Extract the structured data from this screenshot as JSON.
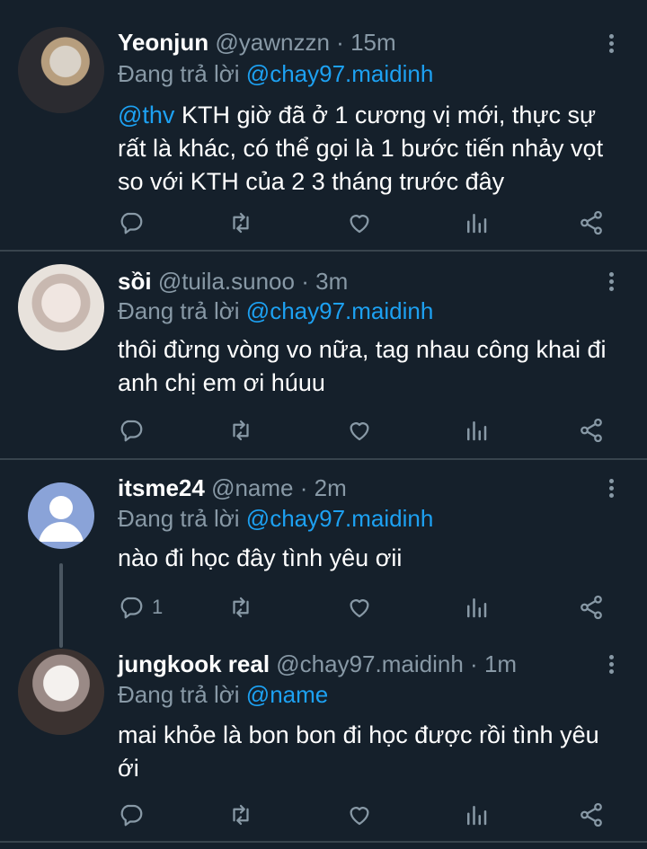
{
  "tweets": [
    {
      "name": "Yeonjun",
      "handle": "@yawnzzn",
      "time": "15m",
      "reply_prefix": "Đang trả lời",
      "reply_to": "@chay97.maidinh",
      "mention": "@thv",
      "text": " KTH giờ đã ở 1 cương vị mới, thực sự rất là khác, có thể gọi là 1 bước tiến nhảy vọt so với KTH của 2 3 tháng trước đây",
      "reply_count": ""
    },
    {
      "name": "sồi",
      "handle": "@tuila.sunoo",
      "time": "3m",
      "reply_prefix": "Đang trả lời",
      "reply_to": "@chay97.maidinh",
      "text": "thôi đừng vòng vo nữa, tag nhau công khai đi anh chị em ơi húuu",
      "reply_count": ""
    },
    {
      "name": "itsme24",
      "handle": "@name",
      "time": "2m",
      "reply_prefix": "Đang trả lời",
      "reply_to": "@chay97.maidinh",
      "text": "nào đi học đây tình yêu ơii",
      "reply_count": "1"
    },
    {
      "name": "jungkook real",
      "handle": "@chay97.maidinh",
      "time": "1m",
      "reply_prefix": "Đang trả lời",
      "reply_to": "@name",
      "text": "mai khỏe là bon bon đi học được rồi tình yêu ới",
      "reply_count": ""
    }
  ],
  "separator": "·",
  "icons": {
    "reply": "reply-icon",
    "retweet": "retweet-icon",
    "like": "heart-icon",
    "analytics": "analytics-icon",
    "share": "share-icon",
    "more": "more-vertical-icon"
  },
  "colors": {
    "background": "#15202b",
    "accent": "#1da1f2",
    "muted": "#8899a6",
    "divider": "#38444d"
  }
}
